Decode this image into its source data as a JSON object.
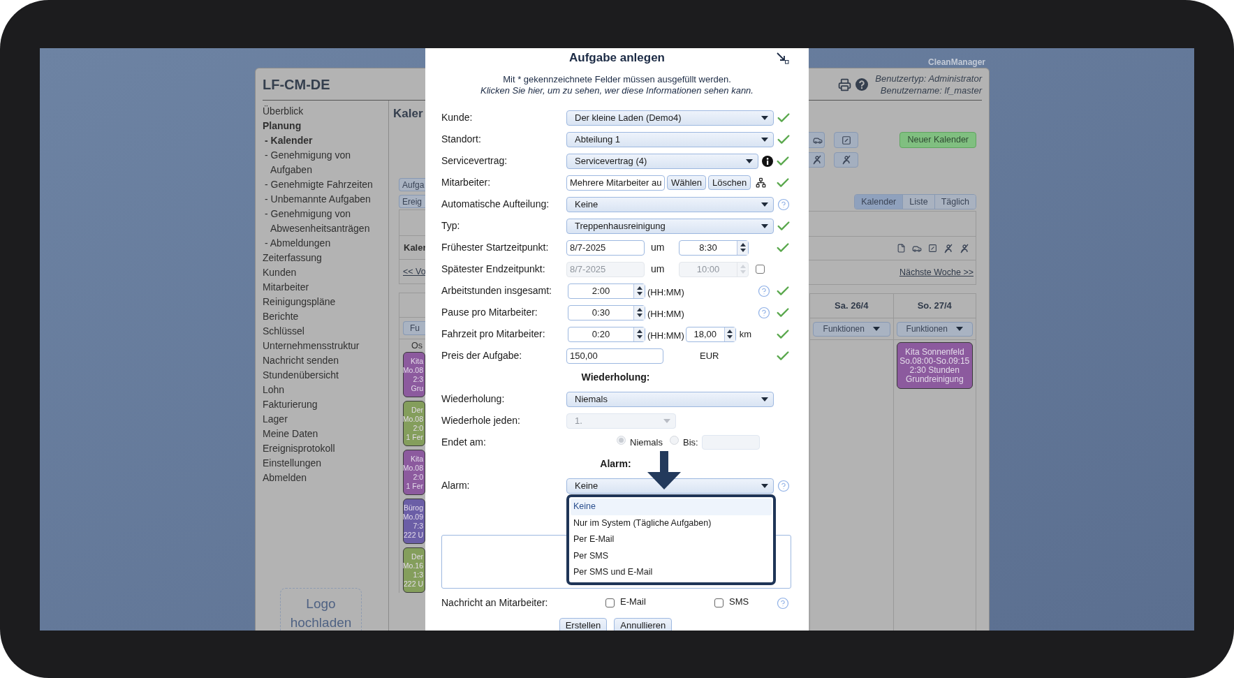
{
  "app": {
    "brand": "CleanManager",
    "title": "LF-CM-DE",
    "user_type": "Benutzertyp: Administrator",
    "user_name": "Benutzername: lf_master"
  },
  "sidebar": {
    "items": [
      {
        "label": "Überblick",
        "kind": "item",
        "selected": false
      },
      {
        "label": "Planung",
        "kind": "item",
        "selected": true
      },
      {
        "label": "- Kalender",
        "kind": "sub",
        "selected": true
      },
      {
        "label": "- Genehmigung von Aufgaben",
        "kind": "sub",
        "selected": false
      },
      {
        "label": "- Genehmigte Fahrzeiten",
        "kind": "sub",
        "selected": false
      },
      {
        "label": "- Unbemannte Aufgaben",
        "kind": "sub",
        "selected": false
      },
      {
        "label": "- Genehmigung von Abwesenheitsanträgen",
        "kind": "sub",
        "selected": false
      },
      {
        "label": "- Abmeldungen",
        "kind": "sub",
        "selected": false
      },
      {
        "label": "Zeiterfassung",
        "kind": "item",
        "selected": false
      },
      {
        "label": "Kunden",
        "kind": "item",
        "selected": false
      },
      {
        "label": "Mitarbeiter",
        "kind": "item",
        "selected": false
      },
      {
        "label": "Reinigungspläne",
        "kind": "item",
        "selected": false
      },
      {
        "label": "Berichte",
        "kind": "item",
        "selected": false
      },
      {
        "label": "Schlüssel",
        "kind": "item",
        "selected": false
      },
      {
        "label": "Unternehmensstruktur",
        "kind": "item",
        "selected": false
      },
      {
        "label": "Nachricht senden",
        "kind": "item",
        "selected": false
      },
      {
        "label": "Stundenübersicht",
        "kind": "item",
        "selected": false
      },
      {
        "label": "Lohn",
        "kind": "item",
        "selected": false
      },
      {
        "label": "Fakturierung",
        "kind": "item",
        "selected": false
      },
      {
        "label": "Lager",
        "kind": "item",
        "selected": false
      },
      {
        "label": "Meine Daten",
        "kind": "item",
        "selected": false
      },
      {
        "label": "Ereignisprotokoll",
        "kind": "item",
        "selected": false
      },
      {
        "label": "Einstellungen",
        "kind": "item",
        "selected": false
      },
      {
        "label": "Abmelden",
        "kind": "item",
        "selected": false
      }
    ],
    "logo_upload": "Logo hochladen"
  },
  "calendar": {
    "heading": "Kaler",
    "buttons": [
      "Aufga",
      "Ereig"
    ],
    "new_calendar": "Neuer Kalender",
    "view_tabs": [
      {
        "label": "Kalender",
        "selected": true
      },
      {
        "label": "Liste",
        "selected": false
      },
      {
        "label": "Täglich",
        "selected": false
      }
    ],
    "panel_title": "Kaler",
    "prev_week": "<< Vo",
    "next_week": "Nächste Woche >>",
    "first_day": {
      "menu": "Fu",
      "section": "Os",
      "events": [
        {
          "lines": [
            "Kita",
            "Mo.08",
            "2:3",
            "Gru"
          ],
          "color": "#8c5a9e"
        },
        {
          "lines": [
            "Der",
            "Mo.08",
            "2:0",
            "1 Fer"
          ],
          "color": "#849e5c"
        },
        {
          "lines": [
            "Kita",
            "Mo.08",
            "2:0",
            "1 Fer"
          ],
          "color": "#8c5a9e"
        },
        {
          "lines": [
            "Bürog",
            "Mo.09",
            "7:3",
            "222 U"
          ],
          "color": "#6b5ea6"
        },
        {
          "lines": [
            "Der",
            "Mo.16",
            "1:3",
            "222 U"
          ],
          "color": "#849e5c"
        }
      ]
    },
    "days": [
      {
        "label": "Sa. 26/4",
        "menu": "Funktionen"
      },
      {
        "label": "So. 27/4",
        "menu": "Funktionen",
        "events": [
          {
            "lines": [
              "Kita Sonnenfeld",
              "So.08:00-So.09:15",
              "2:30 Stunden",
              "Grundreinigung"
            ],
            "color": "#8c5a9e"
          }
        ]
      }
    ]
  },
  "dialog": {
    "title": "Aufgabe anlegen",
    "note": "Mit * gekennzeichnete Felder müssen ausgefüllt werden.",
    "info_link": "Klicken Sie hier, um zu sehen, wer diese Informationen sehen kann.",
    "fields": [
      {
        "kind": "select",
        "label": "Kunde:",
        "value": "Der kleine Laden (Demo4)",
        "valid": true
      },
      {
        "kind": "select",
        "label": "Standort:",
        "value": "Abteilung 1",
        "valid": true
      },
      {
        "kind": "select",
        "label": "Servicevertrag:",
        "value": "Servicevertrag (4)",
        "info": true,
        "valid": true
      },
      {
        "kind": "picker",
        "label": "Mitarbeiter:",
        "value": "Mehrere Mitarbeiter au",
        "buttons": [
          "Wählen",
          "Löschen"
        ],
        "valid": true
      },
      {
        "kind": "select",
        "label": "Automatische Aufteilung:",
        "value": "Keine",
        "help": true
      },
      {
        "kind": "select",
        "label": "Typ:",
        "value": "Treppenhausreinigung",
        "valid": true
      },
      {
        "kind": "datetime",
        "label": "Frühester Startzeitpunkt:",
        "date": "8/7-2025",
        "joiner": "um",
        "time": "8:30",
        "disabled": false,
        "valid": true
      },
      {
        "kind": "datetime",
        "label": "Spätester Endzeitpunkt:",
        "date": "8/7-2025",
        "joiner": "um",
        "time": "10:00",
        "disabled": true,
        "checked": false
      },
      {
        "kind": "duration",
        "label": "Arbeitstunden insgesamt:",
        "value": "2:00",
        "unit": "(HH:MM)",
        "help": true,
        "valid": true
      },
      {
        "kind": "duration",
        "label": "Pause pro Mitarbeiter:",
        "value": "0:30",
        "unit": "(HH:MM)",
        "help": true,
        "valid": true
      },
      {
        "kind": "duration",
        "label": "Fahrzeit pro Mitarbeiter:",
        "value": "0:20",
        "unit": "(HH:MM)",
        "distance": "18,00",
        "distance_unit": "km",
        "valid": true
      },
      {
        "kind": "price",
        "label": "Preis der Aufgabe:",
        "value": "150,00",
        "currency": "EUR",
        "valid": true
      },
      {
        "kind": "heading",
        "label": "Wiederholung:"
      },
      {
        "kind": "select",
        "label": "Wiederholung:",
        "value": "Niemals"
      },
      {
        "kind": "short_select",
        "label": "Wiederhole jeden:",
        "value": "1.",
        "disabled": true
      },
      {
        "kind": "radio",
        "label": "Endet am:",
        "options": [
          {
            "label": "Niemals",
            "selected": true
          },
          {
            "label": "Bis:",
            "selected": false
          }
        ]
      },
      {
        "kind": "heading",
        "label": "Alarm:"
      },
      {
        "kind": "select",
        "label": "Alarm:",
        "value": "Keine",
        "help": true,
        "expanded": true,
        "options": [
          {
            "label": "Keine",
            "selected": true
          },
          {
            "label": "Nur im System (Tägliche Aufgaben)",
            "selected": false
          },
          {
            "label": "Per E-Mail",
            "selected": false
          },
          {
            "label": "Per SMS",
            "selected": false
          },
          {
            "label": "Per SMS und E-Mail",
            "selected": false
          }
        ]
      },
      {
        "kind": "textarea"
      },
      {
        "kind": "checks",
        "label": "Nachricht an Mitarbeiter:",
        "options": [
          {
            "label": "E-Mail",
            "checked": false
          },
          {
            "label": "SMS",
            "checked": false
          }
        ],
        "help": true
      }
    ],
    "buttons": [
      "Erstellen",
      "Annullieren"
    ]
  }
}
